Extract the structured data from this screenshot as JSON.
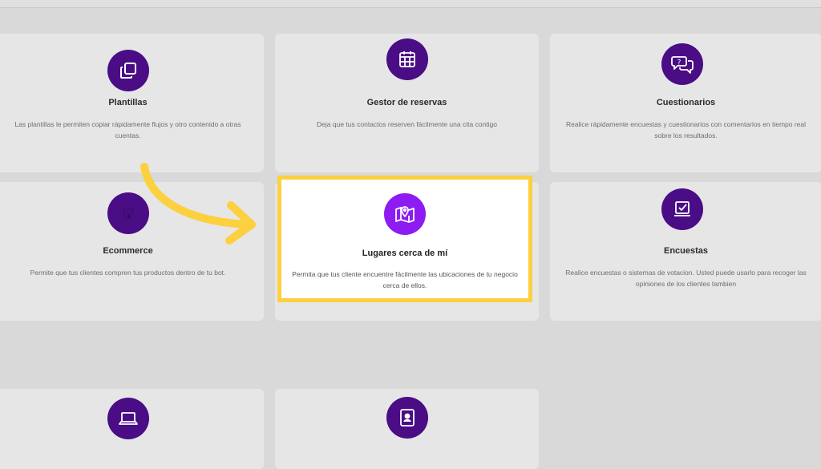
{
  "cards": [
    {
      "title": "Plantillas",
      "desc": "Las plantillas le permiten copiar rápidamente flujos y otro contenido a otras cuentas.",
      "icon": "copy-icon"
    },
    {
      "title": "Gestor de reservas",
      "desc": "Deja que tus contactos reserven fácilmente una cita contigo",
      "icon": "calendar-icon"
    },
    {
      "title": "Cuestionarios",
      "desc": "Realice rápidamente encuestas y cuestionarios con comentarios en tiempo real sobre los resultados.",
      "icon": "question-chat-icon"
    },
    {
      "title": "Ecommerce",
      "desc": "Permite que tus clientes compren tus productos dentro de tu bot.",
      "icon": "store-icon"
    },
    {
      "title": "Lugares cerca de mí",
      "desc": "Permita que tus cliente encuentre fácilmente las ubicaciones de tu negocio cerca de ellos.",
      "icon": "map-pin-icon"
    },
    {
      "title": "Encuestas",
      "desc": "Realice encuestas o sistemas de votacion. Usted puede usarlo para recoger las opiniones de los clientes tambien",
      "icon": "checkbox-icon"
    }
  ],
  "bottom_cards": [
    {
      "icon": "laptop-icon"
    },
    {
      "icon": "contact-card-icon"
    }
  ],
  "colors": {
    "icon_bg": "#4a0d86",
    "icon_bg_highlight": "#8c1cf2",
    "highlight_border": "#fcd03f",
    "arrow": "#fcd03f"
  }
}
